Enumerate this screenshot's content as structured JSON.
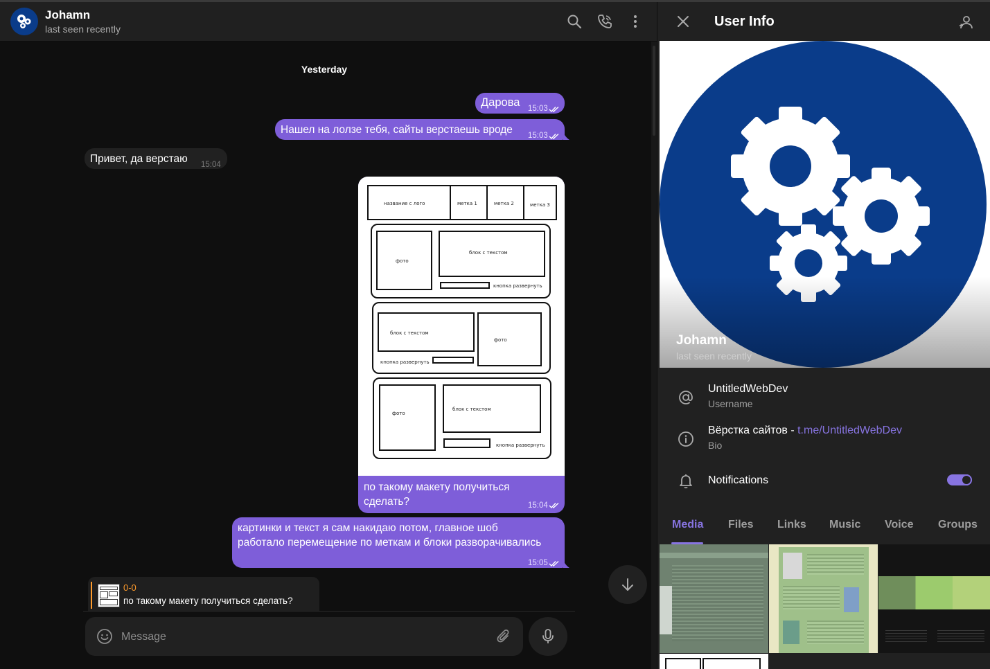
{
  "chat_header": {
    "name": "Johamn",
    "status": "last seen recently"
  },
  "chat": {
    "date_label": "Yesterday",
    "messages": [
      {
        "text": "Дарова",
        "time": "15:03"
      },
      {
        "text": "Нашел на лолзе тебя, сайты верстаешь вроде",
        "time": "15:03"
      },
      {
        "text": "Привет, да верстаю",
        "time": "15:04"
      },
      {
        "caption_line1": "по такому макету получиться",
        "caption_line2": "сделать?",
        "time": "15:04"
      },
      {
        "line1": "картинки и текст я сам накидаю потом, главное шоб",
        "line2": "работало перемещение по меткам и блоки разворачивались",
        "time": "15:05"
      }
    ],
    "wireframe": {
      "header_logo": "название с лого",
      "tag1": "метка 1",
      "tag2": "метка 2",
      "tag3": "метка 3",
      "photo": "фото",
      "text_block": "блок с текстом",
      "expand_button": "кнопка развернуть"
    }
  },
  "reply": {
    "title": "0-0",
    "text": "по такому макету получиться сделать?"
  },
  "composer": {
    "placeholder": "Message"
  },
  "sidebar": {
    "title": "User Info",
    "name": "Johamn",
    "status": "last seen recently",
    "username": "UntitledWebDev",
    "username_label": "Username",
    "bio_text": "Вёрстка сайтов - ",
    "bio_link": "t.me/UntitledWebDev",
    "bio_label": "Bio",
    "notifications_label": "Notifications",
    "notifications_on": true,
    "tabs": [
      "Media",
      "Files",
      "Links",
      "Music",
      "Voice",
      "Groups"
    ]
  },
  "colors": {
    "accent": "#8774e1",
    "outgoing_bubble": "#7e5ed9",
    "avatar_blue": "#0a3c8a",
    "reply_accent": "#ff9b2c"
  }
}
